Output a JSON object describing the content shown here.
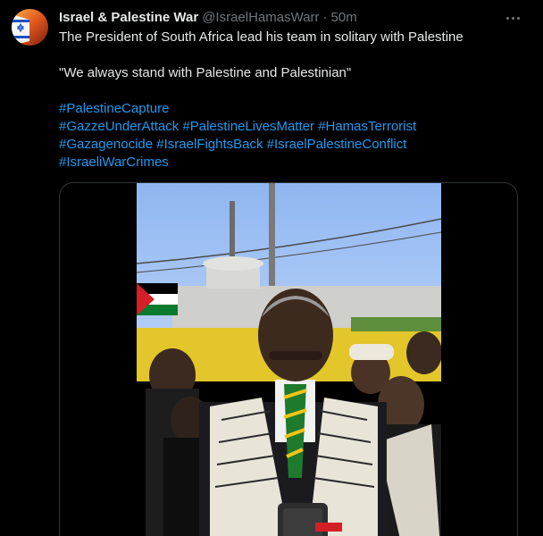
{
  "author": {
    "display_name": "Israel & Palestine War",
    "handle": "@IsraelHamasWarr",
    "separator": "·",
    "time": "50m"
  },
  "tweet": {
    "line1": "The President of South Africa lead his team in solitary with Palestine",
    "line2": "\"We always stand with Palestine and Palestinian\"",
    "hashtags": [
      "#PalestineCapture",
      "#GazzeUnderAttack",
      "#PalestineLivesMatter",
      "#HamasTerrorist",
      "#Gazagenocide",
      "#IsraelFightsBack",
      "#IsraelPalestineConflict",
      "#IsraeliWarCrimes"
    ]
  },
  "icons": {
    "avatar": "avatar-flag-icon",
    "more": "more-options-icon"
  },
  "colors": {
    "background": "#000000",
    "text_primary": "#e7e9ea",
    "text_secondary": "#71767b",
    "link": "#1d9bf0",
    "border": "#2f3336"
  }
}
